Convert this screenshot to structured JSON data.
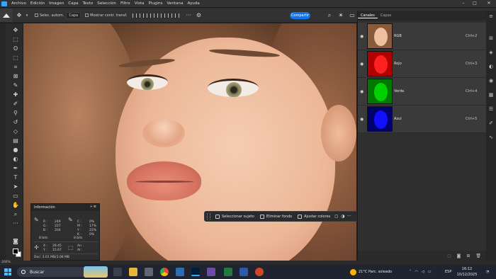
{
  "app": {
    "menu": [
      "Archivo",
      "Edición",
      "Imagen",
      "Capa",
      "Texto",
      "Selección",
      "Filtro",
      "Vista",
      "Plugins",
      "Ventana",
      "Ayuda"
    ]
  },
  "options": {
    "auto_select_label": "Selec. autom.",
    "layer_select": "Capa",
    "transform_label": "Mostrar contr. transf.",
    "share_button": "Compartir"
  },
  "info_panel": {
    "title": "Información",
    "rgb_r": "R :",
    "rgb_r_val": "249",
    "rgb_g": "G :",
    "rgb_g_val": "227",
    "rgb_b": "B :",
    "rgb_b_val": "204",
    "cmyk_c": "C :",
    "cmyk_c_val": "0%",
    "cmyk_m": "M :",
    "cmyk_m_val": "17%",
    "cmyk_y": "Y :",
    "cmyk_y_val": "22%",
    "cmyk_k": "K :",
    "cmyk_k_val": "0%",
    "bits_left": "8 bits",
    "bits_right": "8 bits",
    "x_label": "X :",
    "x_val": "28.45",
    "y_label": "Y :",
    "y_val": "15.67",
    "w_label": "An :",
    "h_label": "Al :",
    "doc": "Doc: 3.01 MB/3.08 MB"
  },
  "context_bar": {
    "select_subject": "Seleccionar sujeto",
    "remove_bg": "Eliminar fondo",
    "adjust_colors": "Ajustar colores"
  },
  "channels_panel": {
    "tab_channels": "Canales",
    "tab_layers": "Capas",
    "channels": [
      {
        "name": "RGB",
        "shortcut": "Ctrl+2"
      },
      {
        "name": "Rojo",
        "shortcut": "Ctrl+3"
      },
      {
        "name": "Verde",
        "shortcut": "Ctrl+4"
      },
      {
        "name": "Azul",
        "shortcut": "Ctrl+5"
      }
    ]
  },
  "status": {
    "zoom": "200%"
  },
  "taskbar": {
    "search_placeholder": "Buscar",
    "weather": "21°C  Parc. soleado",
    "language": "ESP",
    "time": "16:12",
    "date": "10/12/2025"
  },
  "colors": {
    "accent": "#1473e6",
    "red_channel": "#ff0000",
    "green_channel": "#00c800",
    "blue_channel": "#0000ff"
  }
}
